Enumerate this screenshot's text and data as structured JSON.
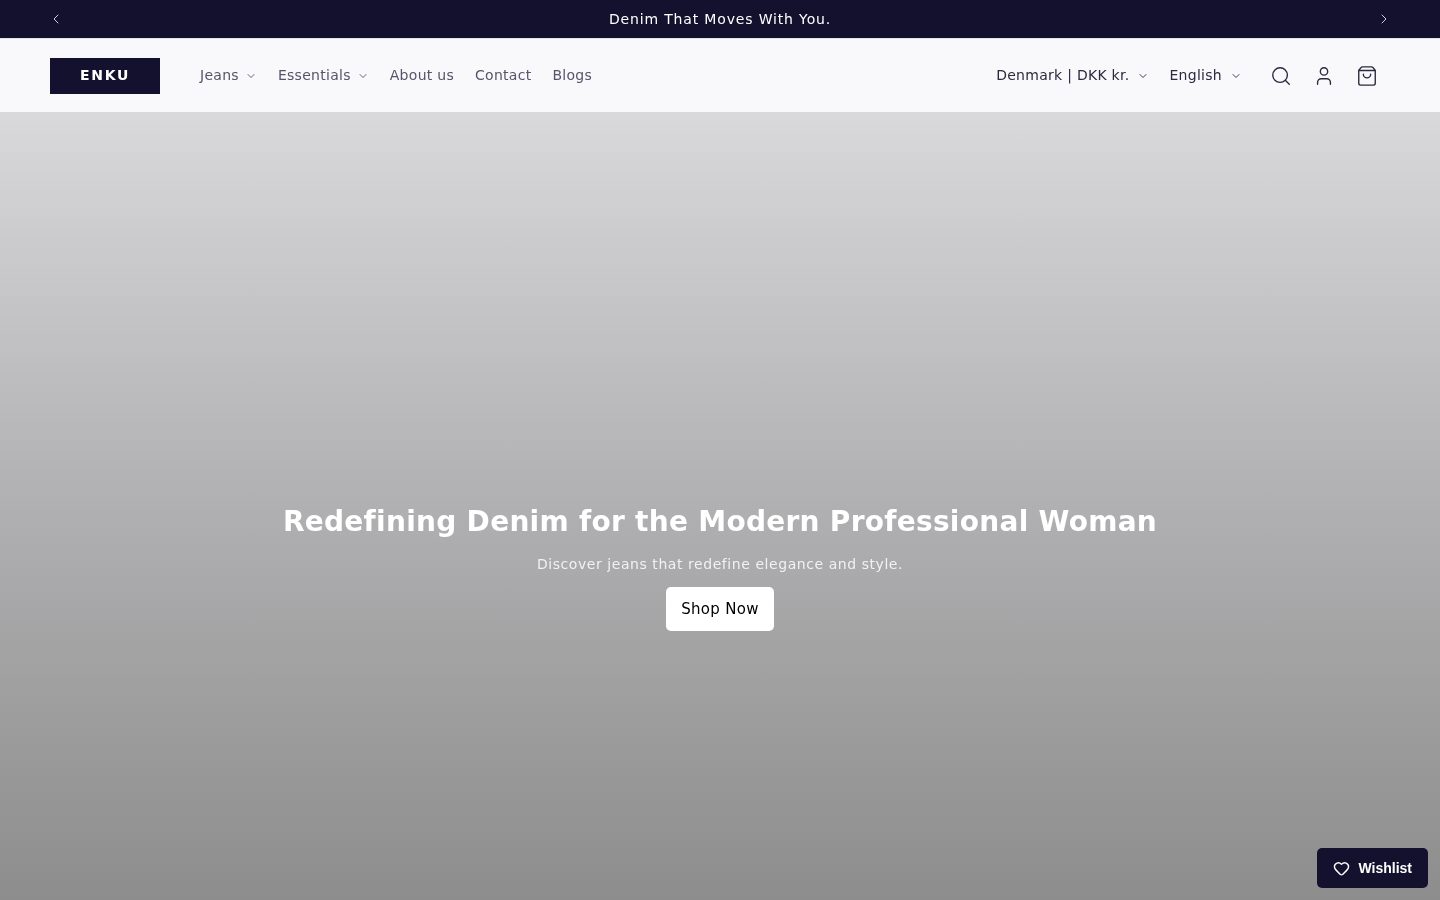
{
  "announcement": {
    "text": "Denim That Moves With You."
  },
  "header": {
    "logo": "ENKU",
    "nav": [
      {
        "label": "Jeans",
        "has_menu": true
      },
      {
        "label": "Essentials",
        "has_menu": true
      },
      {
        "label": "About us",
        "has_menu": false
      },
      {
        "label": "Contact",
        "has_menu": false
      },
      {
        "label": "Blogs",
        "has_menu": false
      }
    ],
    "country": "Denmark | DKK kr.",
    "language": "English"
  },
  "hero": {
    "title": "Redefining Denim for the Modern Professional Woman",
    "subtitle": "Discover jeans that redefine elegance and style.",
    "button": "Shop Now"
  },
  "wishlist": {
    "label": "Wishlist"
  }
}
